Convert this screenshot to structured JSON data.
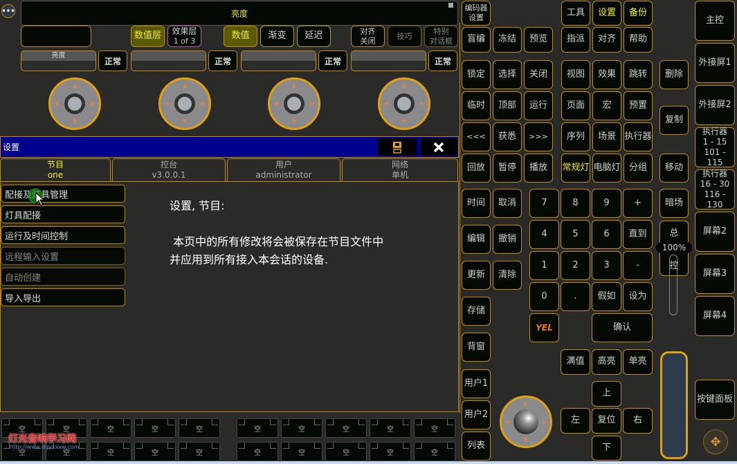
{
  "topbar": {
    "title": "亮度",
    "menu_icon": "more-dots-icon"
  },
  "encoder_row1": {
    "empty_field": "",
    "value_layer": "数值层",
    "effect_layer": "效果层",
    "effect_layer_sub": "1 of 3",
    "value": "数值",
    "fade": "渐变",
    "delay": "延迟",
    "align_off_1": "对齐",
    "align_off_2": "关闭",
    "tricks": "技巧",
    "special_dialog_1": "特别",
    "special_dialog_2": "对话框"
  },
  "encoders": [
    {
      "label": "亮度",
      "mode": "正常"
    },
    {
      "label": "",
      "mode": "正常"
    },
    {
      "label": "",
      "mode": "正常"
    },
    {
      "label": "",
      "mode": "正常"
    }
  ],
  "dialog": {
    "title": "设置",
    "tabs": [
      {
        "label": "节目",
        "sub": "one",
        "active": true
      },
      {
        "label": "控台",
        "sub": "v3.0.0.1",
        "active": false
      },
      {
        "label": "用户",
        "sub": "administrator",
        "active": false
      },
      {
        "label": "网络",
        "sub": "单机",
        "active": false
      }
    ],
    "menu": [
      {
        "label": "配接及灯具管理",
        "enabled": true
      },
      {
        "label": "灯具配接",
        "enabled": true
      },
      {
        "label": "运行及时间控制",
        "enabled": true
      },
      {
        "label": "远程输入设置",
        "enabled": false
      },
      {
        "label": "自动创建",
        "enabled": false
      },
      {
        "label": "导入导出",
        "enabled": true
      }
    ],
    "info_title": "设置, 节目:",
    "info_line1": " 本页中的所有修改将会被保存在节目文件中",
    "info_line2": "并应用到所有接入本会话的设备."
  },
  "executors": {
    "label": "空",
    "count": 20
  },
  "watermark": {
    "title": "灯光音响学习网",
    "url": "http://www.dgyxxxw.com"
  },
  "keys": {
    "encoder_settings_1": "编码器",
    "encoder_settings_2": "设置",
    "blind": "盲编",
    "freeze": "冻结",
    "preview": "预览",
    "lock": "锁定",
    "select": "选择",
    "off": "关闭",
    "temp": "临时",
    "top": "顶部",
    "go": "运行",
    "prev": "<<<",
    "fix": "获悉",
    "next": ">>>",
    "goback": "回放",
    "pause": "暂停",
    "goplay": "播放",
    "time": "时间",
    "esc": "取消",
    "edit": "编辑",
    "oops": "撤销",
    "update": "更新",
    "clear": "清除",
    "store": "存储",
    "background": "背窗",
    "user1": "用户1",
    "user2": "用户2",
    "list": "列表",
    "tools": "工具",
    "setup": "设置",
    "backup": "备份",
    "assign": "指派",
    "align": "对齐",
    "help": "帮助",
    "view": "视图",
    "effect": "效果",
    "goto": "跳转",
    "page": "页面",
    "macro": "宏",
    "preset": "预置",
    "sequence": "序列",
    "cue": "场景",
    "executor": "执行器",
    "channel": "常规灯",
    "fixture": "电脑灯",
    "group": "分组",
    "delete": "删除",
    "copy": "复制",
    "move": "移动",
    "blackout": "暗场",
    "n7": "7",
    "n8": "8",
    "n9": "9",
    "plus": "+",
    "n4": "4",
    "n5": "5",
    "n6": "6",
    "thru": "直到",
    "n1": "1",
    "n2": "2",
    "n3": "3",
    "minus": "-",
    "n0": "0",
    "dot": ".",
    "if": "假如",
    "at": "设为",
    "yel": "YEL",
    "please": "确认",
    "full": "满值",
    "highlight": "高亮",
    "solo": "单亮",
    "up": "上",
    "left": "左",
    "reset": "复位",
    "right": "右",
    "down": "下",
    "gm_top": "总",
    "gm_bottom": "控",
    "gm_value": "100%"
  },
  "views": {
    "main": "主控",
    "ext1": "外接屏1",
    "ext2": "外接屏2",
    "exec1_t": "执行器",
    "exec1_a": "1 - 15",
    "exec1_b": "101 - 115",
    "exec2_t": "执行器",
    "exec2_a": "16 - 30",
    "exec2_b": "116 - 130",
    "screen2": "屏幕2",
    "screen3": "屏幕3",
    "screen4": "屏幕4",
    "keypad": "按键面板"
  },
  "grand_master_percent": 100
}
